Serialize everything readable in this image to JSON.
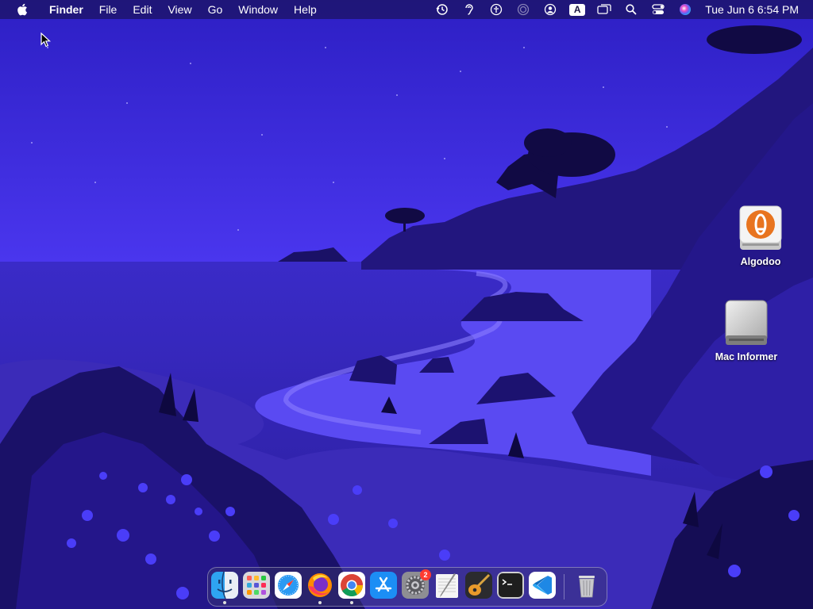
{
  "menubar": {
    "app_name": "Finder",
    "menus": [
      "File",
      "Edit",
      "View",
      "Go",
      "Window",
      "Help"
    ],
    "status_icons": [
      "time-machine-icon",
      "hearing-icon",
      "accessibility-icon",
      "airdrop-icon",
      "user-icon",
      "input-source-icon",
      "screen-mirroring-icon",
      "spotlight-search-icon",
      "control-center-icon",
      "siri-icon"
    ],
    "input_source_label": "A",
    "clock": "Tue Jun 6  6:54 PM"
  },
  "desktop": {
    "icons": [
      {
        "label": "Algodoo",
        "icon": "algodoo-app-icon"
      },
      {
        "label": "Mac Informer",
        "icon": "external-drive-icon"
      }
    ]
  },
  "dock": {
    "apps": [
      {
        "name": "finder",
        "running": true
      },
      {
        "name": "launchpad",
        "running": false
      },
      {
        "name": "safari",
        "running": false
      },
      {
        "name": "firefox",
        "running": true
      },
      {
        "name": "chrome",
        "running": true
      },
      {
        "name": "app-store",
        "running": false
      },
      {
        "name": "system-settings",
        "running": false,
        "badge": "2"
      },
      {
        "name": "script-editor",
        "running": false
      },
      {
        "name": "garageband",
        "running": false
      },
      {
        "name": "terminal",
        "running": false
      },
      {
        "name": "vscode",
        "running": false
      },
      {
        "name": "trash",
        "running": false
      }
    ]
  },
  "colors": {
    "sky": "#3a2ad8",
    "sea": "#3b2cc0",
    "sand": "#4b3ae0",
    "rock": "#1e1470",
    "dark": "#120c4a"
  }
}
